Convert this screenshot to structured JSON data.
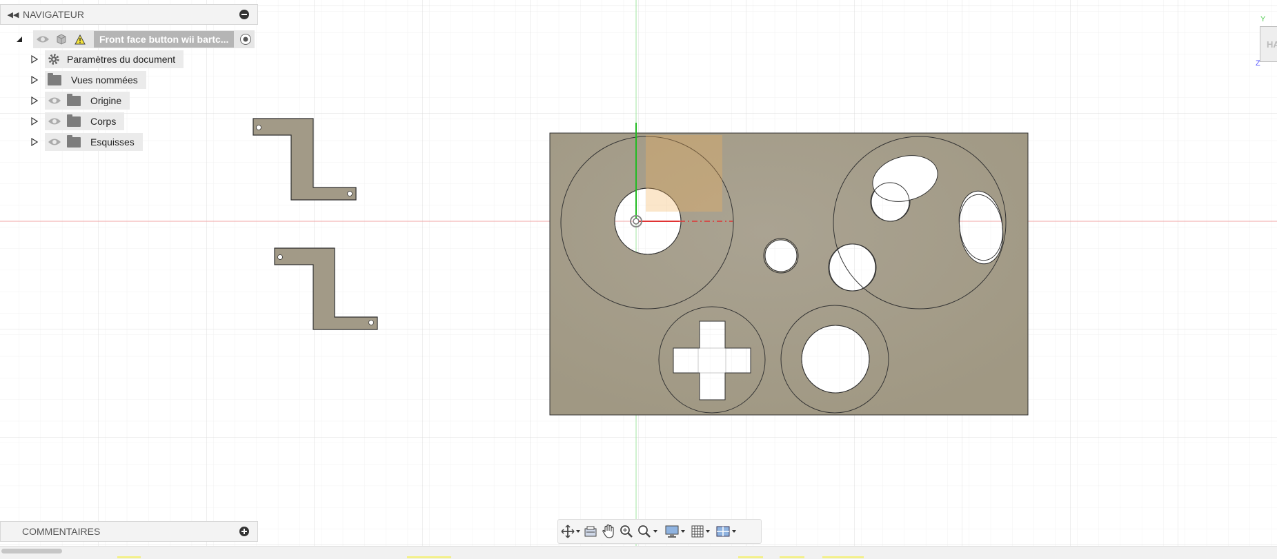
{
  "navigator": {
    "title": "NAVIGATEUR",
    "root": {
      "label": "Front face button wii bartc..."
    },
    "items": [
      {
        "label": "Paramètres du document",
        "icon": "gear-icon",
        "visible_toggle": false
      },
      {
        "label": "Vues nommées",
        "icon": "folder-icon",
        "visible_toggle": false
      },
      {
        "label": "Origine",
        "icon": "folder-icon",
        "visible_toggle": true
      },
      {
        "label": "Corps",
        "icon": "folder-icon",
        "visible_toggle": true
      },
      {
        "label": "Esquisses",
        "icon": "folder-icon",
        "visible_toggle": true
      }
    ]
  },
  "comments": {
    "title": "COMMENTAIRES"
  },
  "viewcube": {
    "face_label": "HA",
    "axis_y": "Y",
    "axis_z": "Z"
  },
  "toolbar": {
    "buttons": [
      "orbit-icon",
      "look-at-icon",
      "pan-icon",
      "zoom-icon",
      "fit-zoom-icon",
      "display-settings-icon",
      "grid-settings-icon",
      "viewports-icon"
    ]
  },
  "colors": {
    "part_fill": "#a29a87",
    "part_stroke": "#3a3a3a",
    "grid_minor": "#f2f2f2",
    "grid_major": "#dedede",
    "axis_x": "#e04040",
    "axis_y": "#44cc44",
    "highlight": "#f4b25a"
  }
}
